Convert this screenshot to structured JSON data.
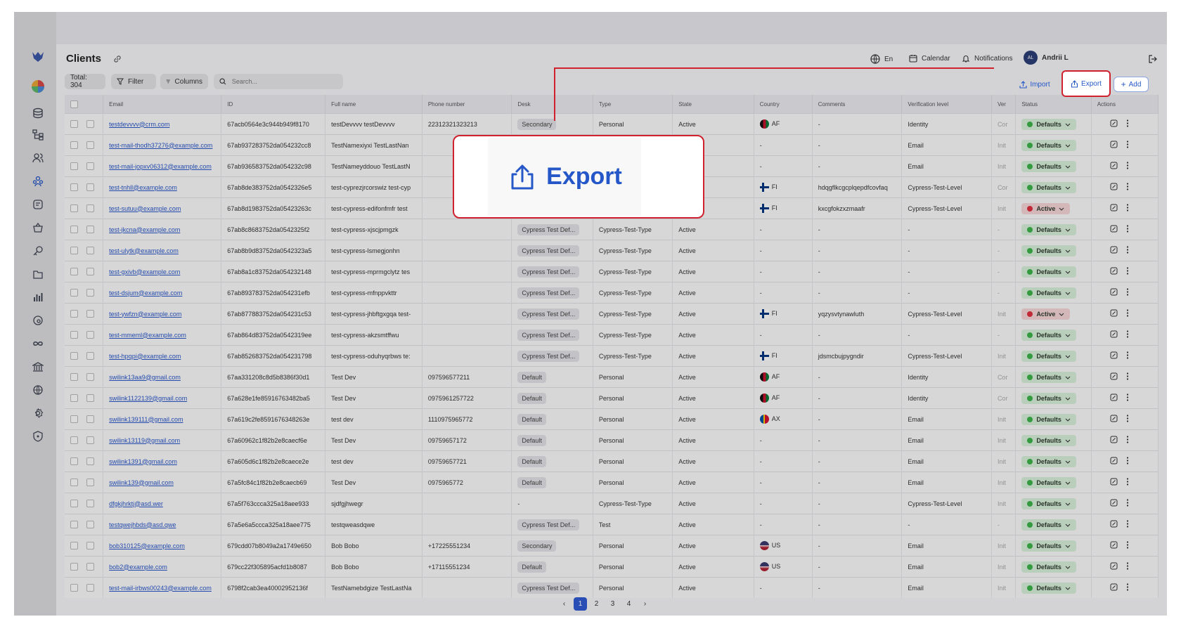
{
  "header": {
    "title": "Clients",
    "language": "En",
    "calendar": "Calendar",
    "notifications": "Notifications",
    "avatar_initials": "AL",
    "user_name": "Andrii L"
  },
  "toolbar": {
    "total": "Total: 304",
    "filter": "Filter",
    "columns": "Columns",
    "search_placeholder": "Search...",
    "import": "Import",
    "export": "Export",
    "add": "Add"
  },
  "callout": {
    "label": "Export"
  },
  "table": {
    "columns": [
      "",
      "Email",
      "ID",
      "Full name",
      "Phone number",
      "Desk",
      "Type",
      "State",
      "Country",
      "Comments",
      "Verification level",
      "Ver",
      "Status",
      "Actions"
    ],
    "rows": [
      {
        "email": "testdevvvv@crm.com",
        "id": "67acb0564e3c944b949f8170",
        "name": "testDevvvv testDevvvv",
        "phone": "22312321323213",
        "desk": "Secondary",
        "type": "Personal",
        "state": "Active",
        "country": "AF",
        "comments": "-",
        "verification": "Identity",
        "ver": "Cor",
        "status": "Defaults",
        "status_kind": "ok"
      },
      {
        "email": "test-mail-thodh37276@example.com",
        "id": "67ab937283752da054232cc8",
        "name": "TestNamexiyxi TestLastNan",
        "phone": "",
        "desk": "",
        "type": "",
        "state": "",
        "country": "-",
        "comments": "-",
        "verification": "Email",
        "ver": "Init",
        "status": "Defaults",
        "status_kind": "ok"
      },
      {
        "email": "test-mail-jopxv06312@example.com",
        "id": "67ab936583752da054232c98",
        "name": "TestNameyddouo TestLastN",
        "phone": "",
        "desk": "",
        "type": "",
        "state": "",
        "country": "-",
        "comments": "-",
        "verification": "Email",
        "ver": "Init",
        "status": "Defaults",
        "status_kind": "ok"
      },
      {
        "email": "test-tnhll@example.com",
        "id": "67ab8de383752da0542326e5",
        "name": "test-cyprezjrcorswiz test-cyp",
        "phone": "",
        "desk": "",
        "type": "",
        "state": "",
        "country": "FI",
        "comments": "hdqgflkcgcplqepdfcovfaq",
        "verification": "Cypress-Test-Level",
        "ver": "Cor",
        "status": "Defaults",
        "status_kind": "ok"
      },
      {
        "email": "test-sutuu@example.com",
        "id": "67ab8d1983752da05423263c",
        "name": "test-cypress-edifonfmfr test",
        "phone": "",
        "desk": "",
        "type": "",
        "state": "",
        "country": "FI",
        "comments": "kxcgfokzxzmaafr",
        "verification": "Cypress-Test-Level",
        "ver": "Init",
        "status": "Active",
        "status_kind": "bad"
      },
      {
        "email": "test-jkcna@example.com",
        "id": "67ab8c8683752da0542325f2",
        "name": "test-cypress-xjscjpmgzk",
        "phone": "",
        "desk": "Cypress Test Def...",
        "type": "Cypress-Test-Type",
        "state": "Active",
        "country": "-",
        "comments": "-",
        "verification": "-",
        "ver": "-",
        "status": "Defaults",
        "status_kind": "ok"
      },
      {
        "email": "test-ulytk@example.com",
        "id": "67ab8b9d83752da0542323a5",
        "name": "test-cypress-lsmegjonhn",
        "phone": "",
        "desk": "Cypress Test Def...",
        "type": "Cypress-Test-Type",
        "state": "Active",
        "country": "-",
        "comments": "-",
        "verification": "-",
        "ver": "-",
        "status": "Defaults",
        "status_kind": "ok"
      },
      {
        "email": "test-gxivb@example.com",
        "id": "67ab8a1c83752da054232148",
        "name": "test-cypress-mprmgclytz tes",
        "phone": "",
        "desk": "Cypress Test Def...",
        "type": "Cypress-Test-Type",
        "state": "Active",
        "country": "-",
        "comments": "-",
        "verification": "-",
        "ver": "-",
        "status": "Defaults",
        "status_kind": "ok"
      },
      {
        "email": "test-dsjum@example.com",
        "id": "67ab893783752da054231efb",
        "name": "test-cypress-mfnppvkttr",
        "phone": "",
        "desk": "Cypress Test Def...",
        "type": "Cypress-Test-Type",
        "state": "Active",
        "country": "-",
        "comments": "-",
        "verification": "-",
        "ver": "-",
        "status": "Defaults",
        "status_kind": "ok"
      },
      {
        "email": "test-ywfzn@example.com",
        "id": "67ab877883752da054231c53",
        "name": "test-cypress-jhbftgxgqa test-",
        "phone": "",
        "desk": "Cypress Test Def...",
        "type": "Cypress-Test-Type",
        "state": "Active",
        "country": "FI",
        "comments": "yqzysvtynawluth",
        "verification": "Cypress-Test-Level",
        "ver": "Init",
        "status": "Active",
        "status_kind": "bad"
      },
      {
        "email": "test-mmeml@example.com",
        "id": "67ab864d83752da0542319ee",
        "name": "test-cypress-akzsmtffwu",
        "phone": "",
        "desk": "Cypress Test Def...",
        "type": "Cypress-Test-Type",
        "state": "Active",
        "country": "-",
        "comments": "-",
        "verification": "-",
        "ver": "-",
        "status": "Defaults",
        "status_kind": "ok"
      },
      {
        "email": "test-hpqpi@example.com",
        "id": "67ab852683752da054231798",
        "name": "test-cypress-oduhyqrbws te:",
        "phone": "",
        "desk": "Cypress Test Def...",
        "type": "Cypress-Test-Type",
        "state": "Active",
        "country": "FI",
        "comments": "jdsmcbujpygndir",
        "verification": "Cypress-Test-Level",
        "ver": "Init",
        "status": "Defaults",
        "status_kind": "ok"
      },
      {
        "email": "swilink13aa9@gmail.com",
        "id": "67aa331208c8d5b8386f30d1",
        "name": "Test Dev",
        "phone": "097596577211",
        "desk": "Default",
        "type": "Personal",
        "state": "Active",
        "country": "AF",
        "comments": "-",
        "verification": "Identity",
        "ver": "Cor",
        "status": "Defaults",
        "status_kind": "ok"
      },
      {
        "email": "swilink1122139@gmail.com",
        "id": "67a628e1fe85916763482ba5",
        "name": "Test Dev",
        "phone": "0975961257722",
        "desk": "Default",
        "type": "Personal",
        "state": "Active",
        "country": "AF",
        "comments": "-",
        "verification": "Identity",
        "ver": "Cor",
        "status": "Defaults",
        "status_kind": "ok"
      },
      {
        "email": "swilink139111@gmail.com",
        "id": "67a619c2fe8591676348263e",
        "name": "test dev",
        "phone": "1110975965772",
        "desk": "Default",
        "type": "Personal",
        "state": "Active",
        "country": "AX",
        "comments": "-",
        "verification": "Email",
        "ver": "Init",
        "status": "Defaults",
        "status_kind": "ok"
      },
      {
        "email": "swilink13119@gmail.com",
        "id": "67a60962c1f82b2e8caecf6e",
        "name": "Test Dev",
        "phone": "09759657172",
        "desk": "Default",
        "type": "Personal",
        "state": "Active",
        "country": "-",
        "comments": "-",
        "verification": "Email",
        "ver": "Init",
        "status": "Defaults",
        "status_kind": "ok"
      },
      {
        "email": "swilink1391@gmail.com",
        "id": "67a605d6c1f82b2e8caece2e",
        "name": "test dev",
        "phone": "09759657721",
        "desk": "Default",
        "type": "Personal",
        "state": "Active",
        "country": "-",
        "comments": "-",
        "verification": "Email",
        "ver": "Init",
        "status": "Defaults",
        "status_kind": "ok"
      },
      {
        "email": "swilink139@gmail.com",
        "id": "67a5fc84c1f82b2e8caecb69",
        "name": "Test Dev",
        "phone": "0975965772",
        "desk": "Default",
        "type": "Personal",
        "state": "Active",
        "country": "-",
        "comments": "-",
        "verification": "Email",
        "ver": "Init",
        "status": "Defaults",
        "status_kind": "ok"
      },
      {
        "email": "dfgkjhrktj@asd.wer",
        "id": "67a5f763ccca325a18aee933",
        "name": "sjdfgjhwegr",
        "phone": "",
        "desk": "-",
        "type": "Cypress-Test-Type",
        "state": "Active",
        "country": "-",
        "comments": "-",
        "verification": "Cypress-Test-Level",
        "ver": "Init",
        "status": "Defaults",
        "status_kind": "ok"
      },
      {
        "email": "testqwejhbds@asd.qwe",
        "id": "67a5e6a5ccca325a18aee775",
        "name": "testqweasdqwe",
        "phone": "",
        "desk": "Cypress Test Def...",
        "type": "Test",
        "state": "Active",
        "country": "-",
        "comments": "-",
        "verification": "-",
        "ver": "-",
        "status": "Defaults",
        "status_kind": "ok"
      },
      {
        "email": "bob310125@example.com",
        "id": "679cdd07b8049a2a1749e650",
        "name": "Bob Bobo",
        "phone": "+17225551234",
        "desk": "Secondary",
        "type": "Personal",
        "state": "Active",
        "country": "US",
        "comments": "-",
        "verification": "Email",
        "ver": "Init",
        "status": "Defaults",
        "status_kind": "ok"
      },
      {
        "email": "bob2@example.com",
        "id": "679cc22f305895acfd1b8087",
        "name": "Bob Bobo",
        "phone": "+17115551234",
        "desk": "Default",
        "type": "Personal",
        "state": "Active",
        "country": "US",
        "comments": "-",
        "verification": "Email",
        "ver": "Init",
        "status": "Defaults",
        "status_kind": "ok"
      },
      {
        "email": "test-mail-irbws00243@example.com",
        "id": "6798f2cab3ea40002952136f",
        "name": "TestNamebdgize TestLastNa",
        "phone": "",
        "desk": "Cypress Test Def...",
        "type": "Personal",
        "state": "Active",
        "country": "-",
        "comments": "-",
        "verification": "Email",
        "ver": "Init",
        "status": "Defaults",
        "status_kind": "ok"
      }
    ]
  },
  "pagination": {
    "prev": "‹",
    "next": "›",
    "pages": [
      "1",
      "2",
      "3",
      "4"
    ],
    "current": "1"
  },
  "colors": {
    "accent": "#2557c9",
    "highlight": "#d0212f",
    "status_ok": "#3cb44b",
    "status_bad": "#e0313f"
  }
}
